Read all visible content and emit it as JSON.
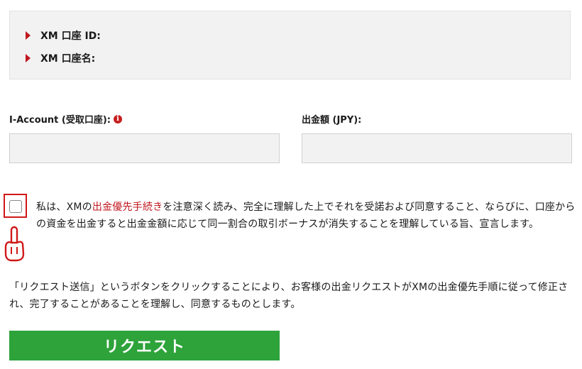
{
  "account_info": {
    "account_id_label": "XM 口座 ID:",
    "account_name_label": "XM 口座名:"
  },
  "form": {
    "iaccount_label": "I-Account (受取口座):",
    "iaccount_value": "",
    "amount_label": "出金額 (JPY):",
    "amount_value": ""
  },
  "agreement": {
    "checked": false,
    "text_before": "私は、XMの",
    "link_text": "出金優先手続き",
    "text_after": "を注意深く読み、完全に理解した上でそれを受諾および同意すること、ならびに、口座からの資金を出金すると出金金額に応じて同一割合の取引ボーナスが消失することを理解している旨、宣言します。"
  },
  "notice": "「リクエスト送信」というボタンをクリックすることにより、お客様の出金リクエストがXMの出金優先手順に従って修正され、完了することがあることを理解し、同意するものとします。",
  "submit_label": "リクエスト",
  "colors": {
    "accent_red": "#c0161f",
    "button_green": "#2da33a",
    "panel_gray": "#f2f2f2"
  }
}
